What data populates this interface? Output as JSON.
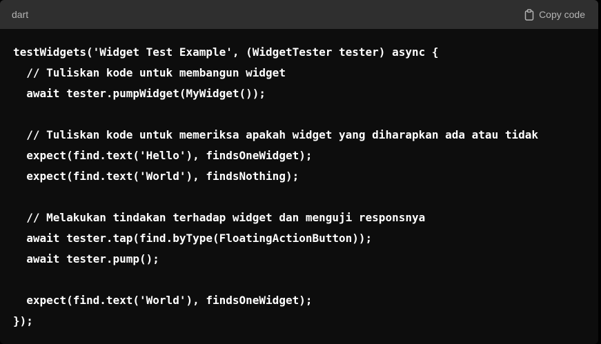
{
  "header": {
    "language": "dart",
    "copy_label": "Copy code",
    "copy_icon": "clipboard-icon"
  },
  "code": {
    "lines": [
      "testWidgets('Widget Test Example', (WidgetTester tester) async {",
      "  // Tuliskan kode untuk membangun widget",
      "  await tester.pumpWidget(MyWidget());",
      "",
      "  // Tuliskan kode untuk memeriksa apakah widget yang diharapkan ada atau tidak",
      "  expect(find.text('Hello'), findsOneWidget);",
      "  expect(find.text('World'), findsNothing);",
      "",
      "  // Melakukan tindakan terhadap widget dan menguji responsnya",
      "  await tester.tap(find.byType(FloatingActionButton));",
      "  await tester.pump();",
      "",
      "  expect(find.text('World'), findsOneWidget);",
      "});"
    ]
  },
  "colors": {
    "header_bg": "#2f2f2f",
    "code_bg": "#0d0d0d",
    "text": "#ffffff",
    "muted": "#b4b4b4"
  }
}
